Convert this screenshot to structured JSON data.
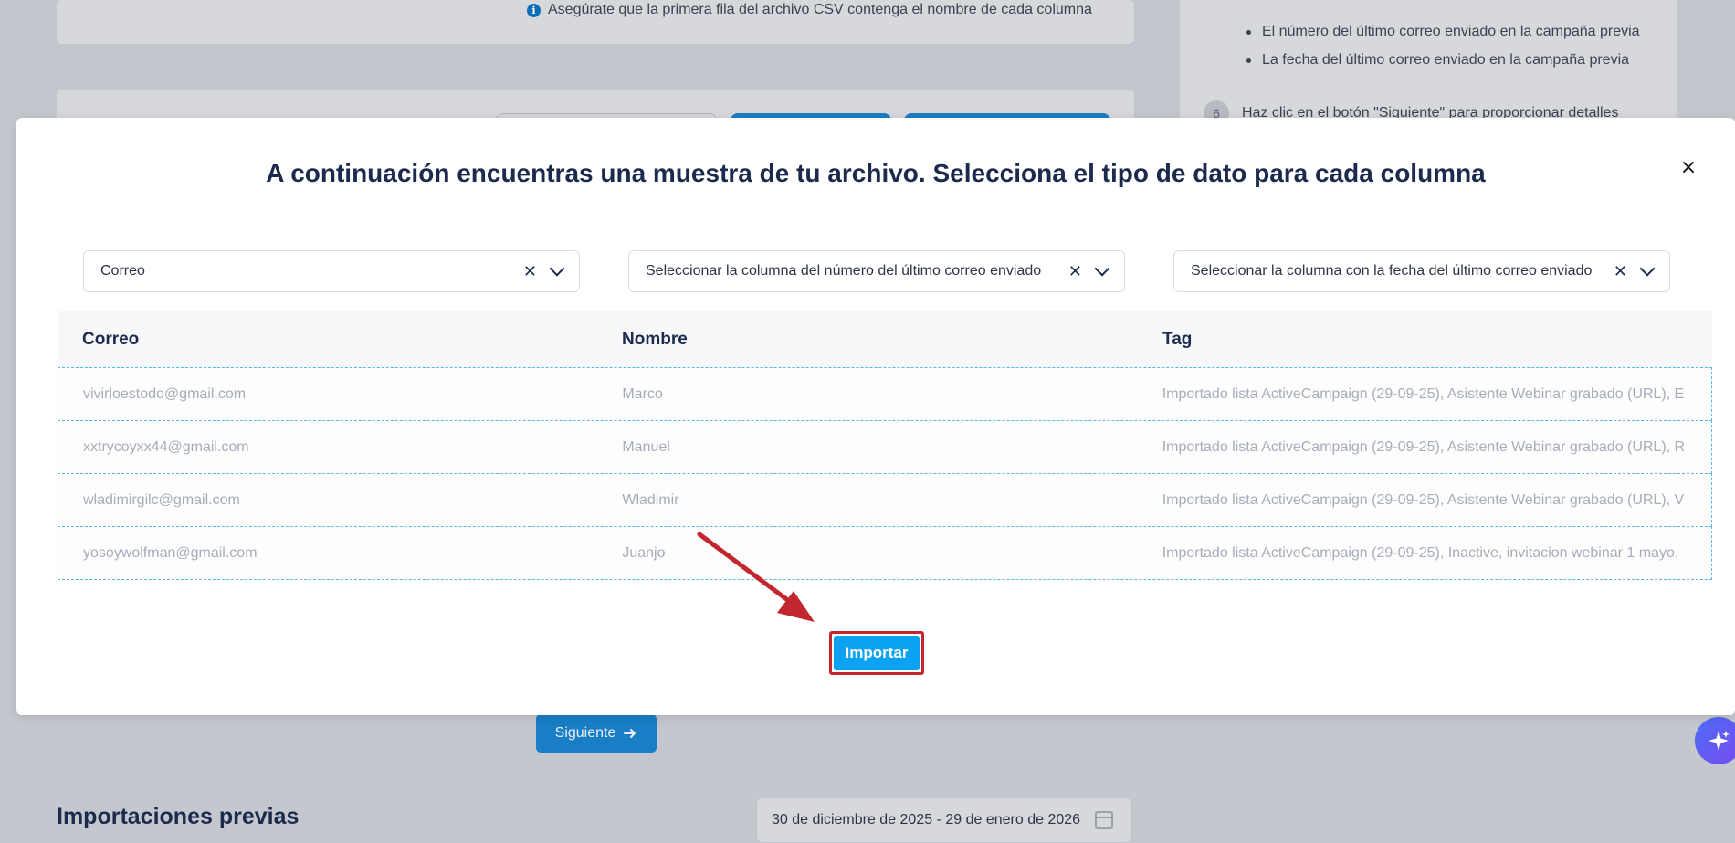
{
  "background": {
    "info_text": "Asegúrate que la primera fila del archivo CSV contenga el nombre de cada columna",
    "side_bullets": [
      "El número del último correo enviado en la campaña previa",
      "La fecha del último correo enviado en la campaña previa"
    ],
    "step_number": "6",
    "step_text": "Haz clic en el botón \"Siguiente\" para proporcionar detalles",
    "next_button": "Siguiente",
    "previous_imports_title": "Importaciones previas",
    "date_range": "30 de diciembre de 2025 - 29 de enero de 2026"
  },
  "modal": {
    "title": "A continuación encuentras una muestra de tu archivo. Selecciona el tipo de dato para cada columna",
    "close_label": "×",
    "selects": [
      {
        "value": "Correo"
      },
      {
        "value": "Seleccionar la columna del número del último correo enviado"
      },
      {
        "value": "Seleccionar la columna con la fecha del último correo enviado"
      }
    ],
    "table": {
      "headers": [
        "Correo",
        "Nombre",
        "Tag"
      ],
      "rows": [
        [
          "vivirloestodo@gmail.com",
          "Marco",
          "Importado lista ActiveCampaign (29-09-25), Asistente Webinar grabado (URL), E"
        ],
        [
          "xxtrycoyxx44@gmail.com",
          "Manuel",
          "Importado lista ActiveCampaign (29-09-25), Asistente Webinar grabado (URL), R"
        ],
        [
          "wladimirgilc@gmail.com",
          "Wladimir",
          "Importado lista ActiveCampaign (29-09-25), Asistente Webinar grabado (URL), V"
        ],
        [
          "yosoywolfman@gmail.com",
          "Juanjo",
          "Importado lista ActiveCampaign (29-09-25), Inactive, invitacion webinar 1 mayo,"
        ]
      ]
    },
    "import_button": "Importar"
  },
  "colors": {
    "accent": "#0ba2f2",
    "highlight": "#c1272d",
    "title": "#1c2a4d"
  },
  "icons": [
    "info-icon",
    "close-icon",
    "clear-icon",
    "chevron-down-icon",
    "arrow-right-icon",
    "calendar-icon",
    "sparkle-icon"
  ]
}
